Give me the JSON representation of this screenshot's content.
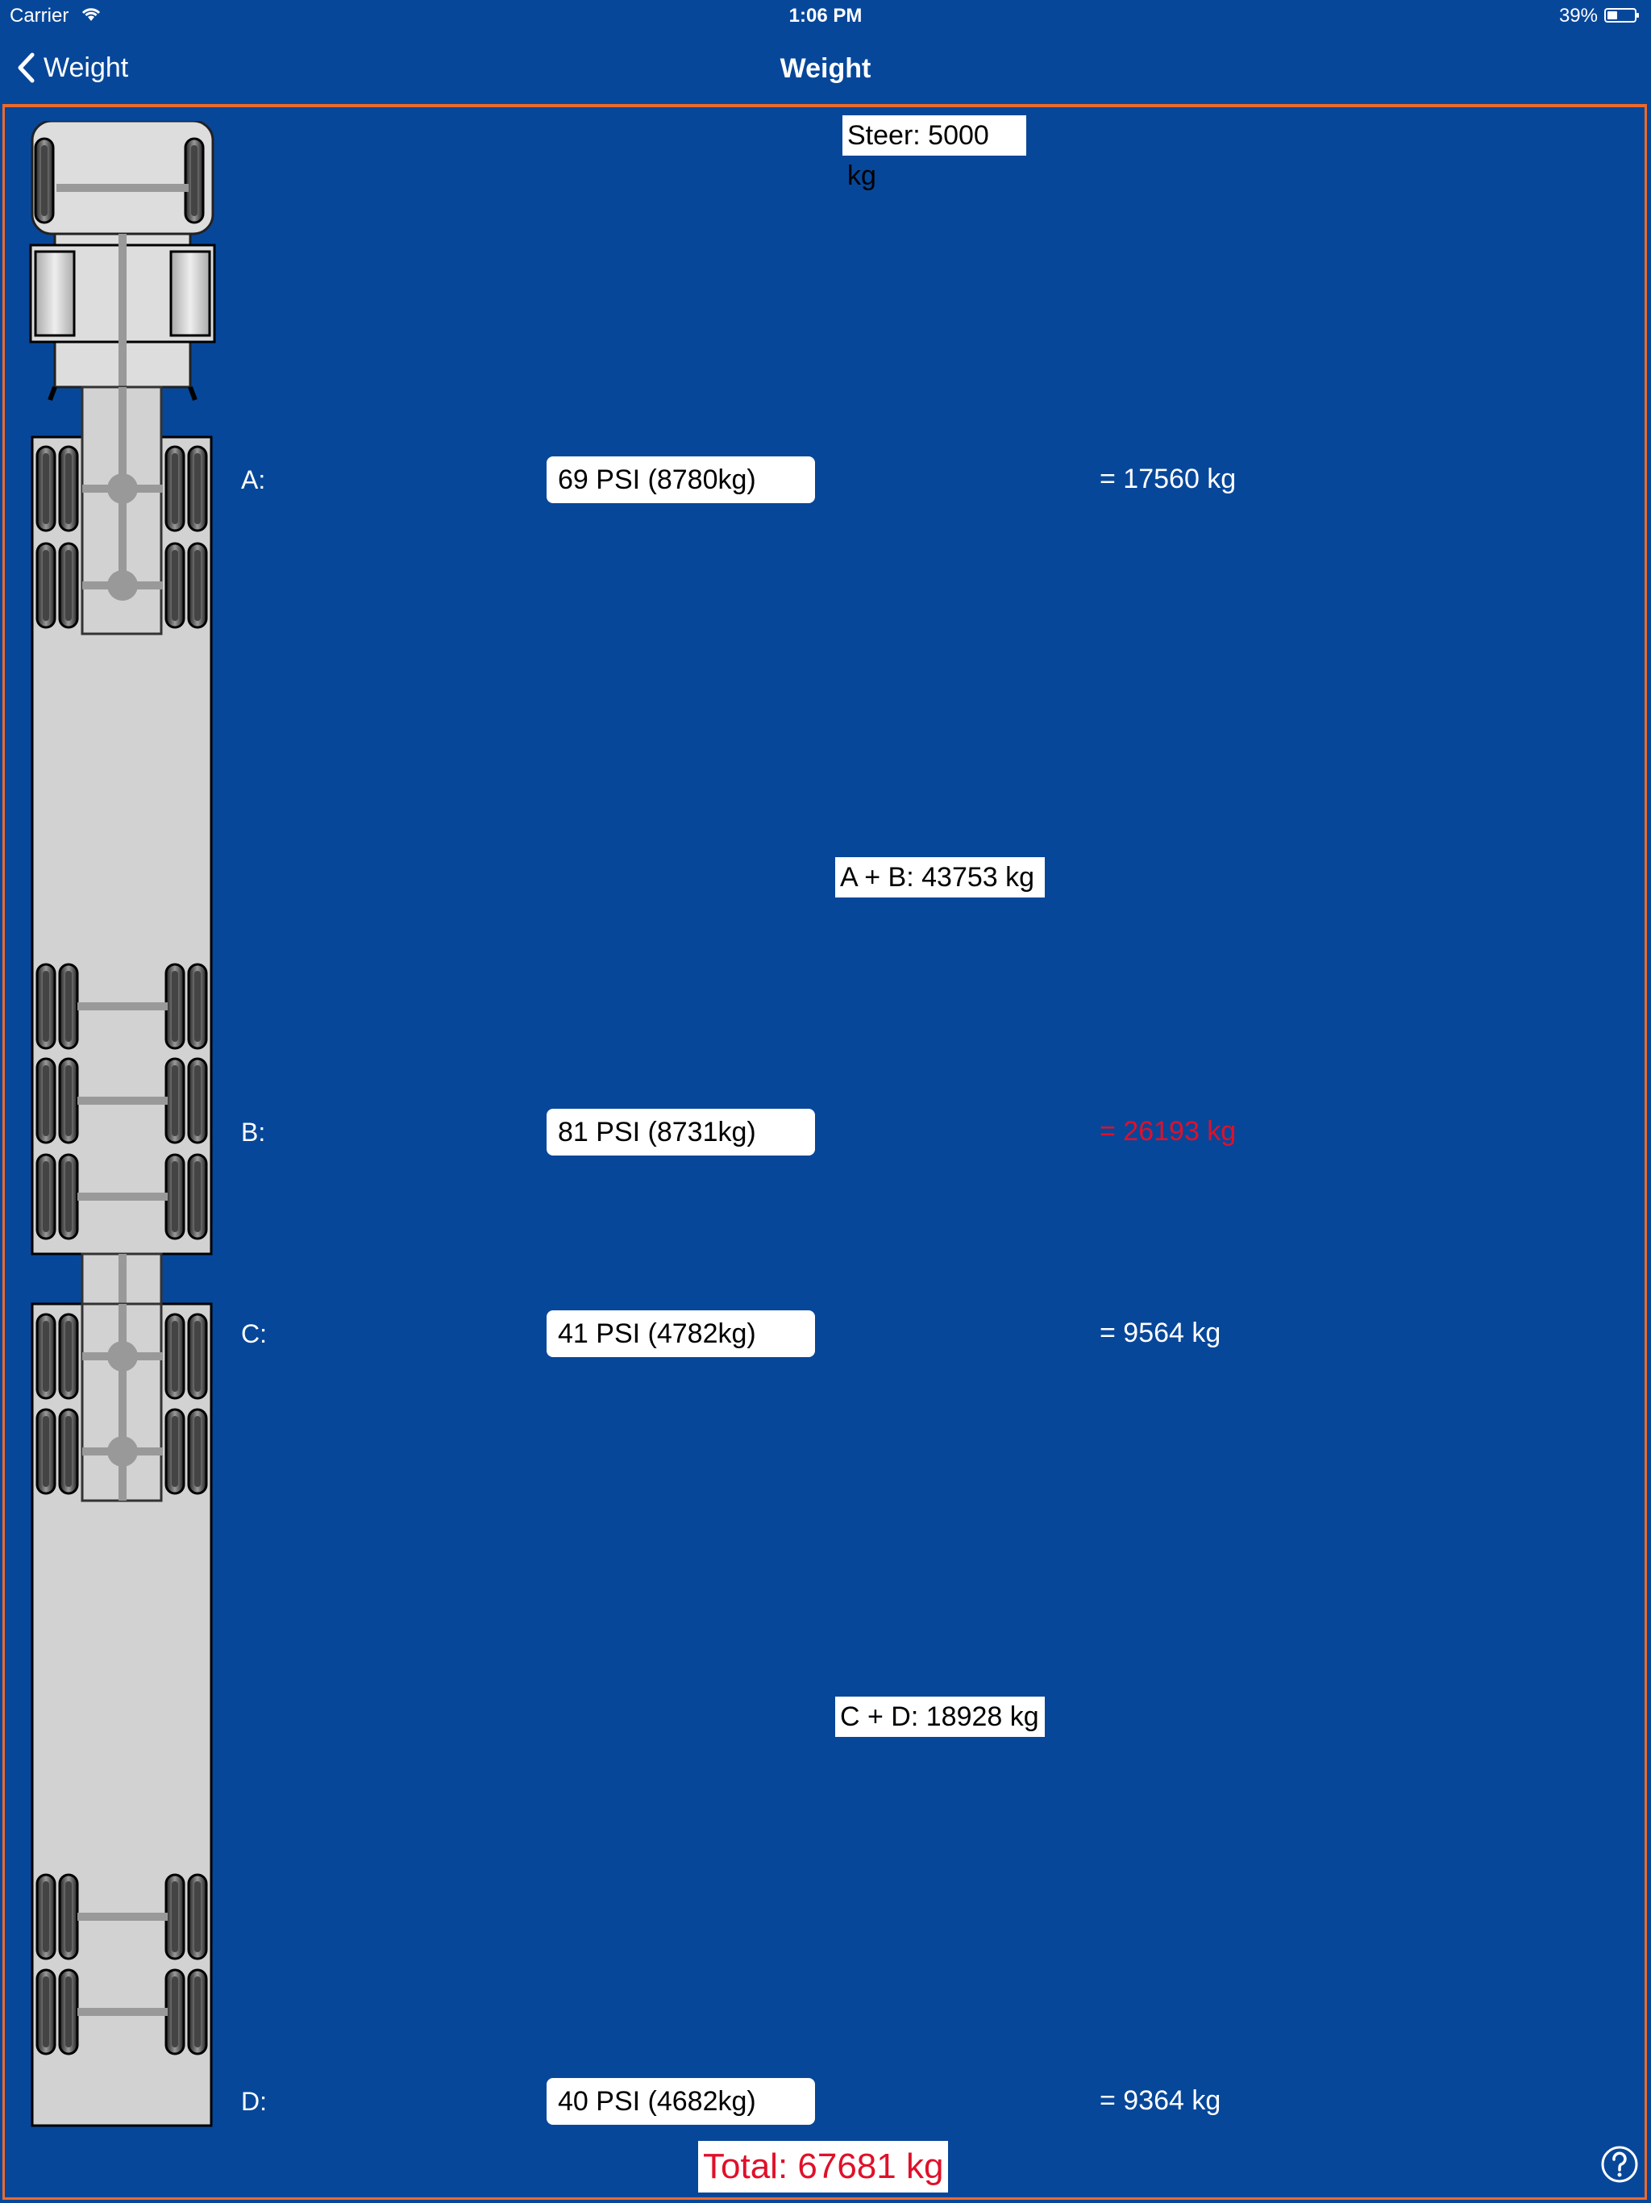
{
  "status_bar": {
    "carrier": "Carrier",
    "time": "1:06 PM",
    "battery": "39%",
    "battery_level": 0.39
  },
  "nav": {
    "back_label": "Weight",
    "title": "Weight"
  },
  "steer": "Steer: 5000 kg",
  "axles": [
    {
      "label": "A:",
      "value": "69 PSI (8780kg)",
      "result": "= 17560 kg",
      "warning": false
    },
    {
      "label": "B:",
      "value": "81 PSI (8731kg)",
      "result": "= 26193 kg",
      "warning": true
    },
    {
      "label": "C:",
      "value": "41 PSI (4782kg)",
      "result": "= 9564 kg",
      "warning": false
    },
    {
      "label": "D:",
      "value": "40 PSI (4682kg)",
      "result": "= 9364 kg",
      "warning": false
    }
  ],
  "group_ab": "A + B: 43753 kg",
  "group_cd": "C + D: 18928 kg",
  "total": "Total: 67681 kg",
  "colors": {
    "background": "#07479a",
    "border": "#ee6a2a",
    "warning": "#e0102a"
  },
  "icons": {
    "back": "chevron-left-icon",
    "help": "question-circle-icon",
    "wifi": "wifi-icon",
    "battery": "battery-icon"
  }
}
